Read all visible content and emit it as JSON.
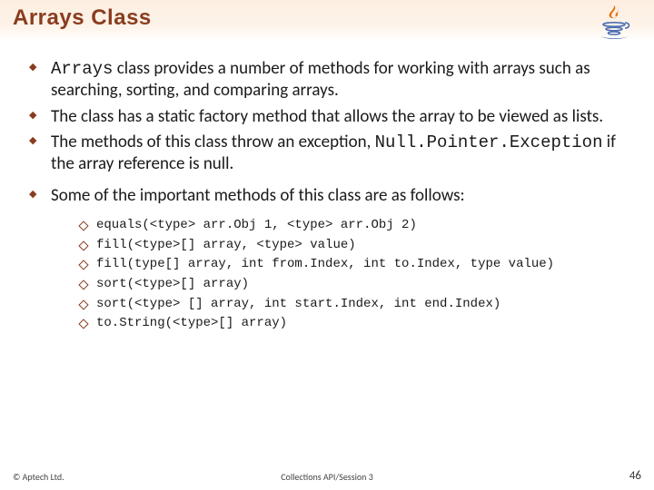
{
  "title": "Arrays Class",
  "logo_name": "java-logo",
  "bullets": [
    {
      "parts": [
        {
          "text": "Arrays",
          "code": true
        },
        {
          "text": " class provides a number of methods for working with arrays such as searching, sorting, and comparing arrays."
        }
      ]
    },
    {
      "parts": [
        {
          "text": "The class has a static factory method that allows the array to be viewed as lists."
        }
      ]
    },
    {
      "parts": [
        {
          "text": "The methods of this class throw an exception, "
        },
        {
          "text": "Null.Pointer.Exception",
          "code": true
        },
        {
          "text": " if the array reference is null."
        }
      ]
    },
    {
      "gap_before": true,
      "parts": [
        {
          "text": "Some of the important methods of this class are as follows:"
        }
      ],
      "sub": [
        "equals(<type> arr.Obj 1, <type> arr.Obj 2)",
        "fill(<type>[] array, <type> value)",
        "fill(type[] array, int from.Index, int to.Index, type value)",
        "sort(<type>[] array)",
        "sort(<type> [] array, int start.Index, int end.Index)",
        "to.String(<type>[] array)"
      ]
    }
  ],
  "footer": {
    "copyright": "© Aptech Ltd.",
    "session": "Collections API/Session 3",
    "page": "46"
  }
}
